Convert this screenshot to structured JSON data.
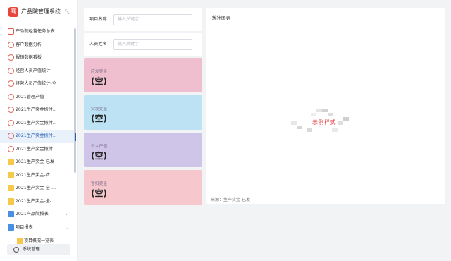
{
  "brand": {
    "logo_glyph": "骞",
    "title": "产品院管理系统...",
    "collapse_glyph": "⤡"
  },
  "sidebar": {
    "items": [
      {
        "label": "产品院经营任务总表",
        "icon": "sq-red"
      },
      {
        "label": "客户数据分析",
        "icon": "circle-red"
      },
      {
        "label": "报销数据看板",
        "icon": "circle-red"
      },
      {
        "label": "经营人员产值统计",
        "icon": "circle-red"
      },
      {
        "label": "经营人员产值统计-全",
        "icon": "circle-red"
      },
      {
        "label": "2021管理产值",
        "icon": "circle-red"
      },
      {
        "label": "2021生产奖金拨付...",
        "icon": "circle-red"
      },
      {
        "label": "2021生产奖金拨付...",
        "icon": "circle-red"
      },
      {
        "label": "2021生产奖金拨付...",
        "icon": "circle-red",
        "active": true
      },
      {
        "label": "2021生产奖金拨付...",
        "icon": "circle-red"
      },
      {
        "label": "2021生产奖金-已发",
        "icon": "sq-yellow"
      },
      {
        "label": "2021生产奖金-应...",
        "icon": "sq-yellow"
      },
      {
        "label": "2021生产奖金-全-...",
        "icon": "sq-yellow"
      },
      {
        "label": "2021生产奖金-全-...",
        "icon": "sq-yellow"
      },
      {
        "label": "2021产品院报表",
        "icon": "folder",
        "arrow": "›"
      },
      {
        "label": "项目报表",
        "icon": "folder",
        "arrow": "⌄"
      }
    ],
    "sub_item": "项目概况一览表",
    "system": "系统管理"
  },
  "filters": [
    {
      "label": "项目名称",
      "placeholder": "输入关键字"
    },
    {
      "label": "人员姓名",
      "placeholder": "输入关键字"
    }
  ],
  "cards": [
    {
      "title": "应发奖金",
      "value": "(空)",
      "color": "#efbfcf"
    },
    {
      "title": "实发奖金",
      "value": "(空)",
      "color": "#bde2f4"
    },
    {
      "title": "个人产值",
      "value": "(空)",
      "color": "#cfc5e8"
    },
    {
      "title": "暂扣奖金",
      "value": "(空)",
      "color": "#f6c7cd"
    }
  ],
  "chart": {
    "title": "统计图表",
    "sample_text": "示例样式",
    "source": "来源：生产奖金-已发"
  }
}
